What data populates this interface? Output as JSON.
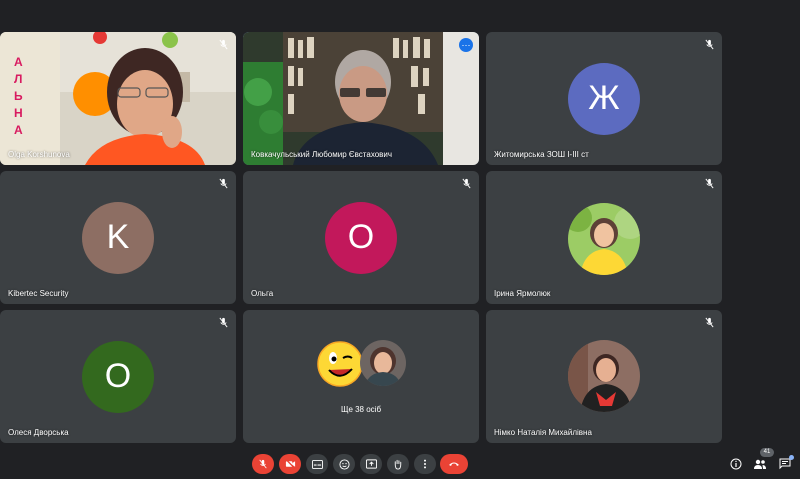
{
  "tiles": [
    {
      "name": "Olga Korshunova",
      "type": "video"
    },
    {
      "name": "Ковкачульський Любомир Євстахович",
      "type": "video",
      "active": true
    },
    {
      "name": "Житомирська ЗОШ І-ІІІ ст",
      "type": "avatar",
      "initial": "Ж",
      "color": "#5c6bc0"
    },
    {
      "name": "Kibertec Security",
      "type": "avatar",
      "initial": "K",
      "color": "#8d6e63"
    },
    {
      "name": "Ольга",
      "type": "avatar",
      "initial": "О",
      "color": "#c2185b"
    },
    {
      "name": "Ірина Ярмолюк",
      "type": "photo"
    },
    {
      "name": "Олеся Дворська",
      "type": "avatar",
      "initial": "О",
      "color": "#33691e"
    },
    {
      "others_label": "Ще 38 осіб",
      "type": "others"
    },
    {
      "name": "Німко Наталія Михайлівна",
      "type": "photo"
    }
  ],
  "poster_text": "АЛЬНА",
  "participants_count": "41",
  "colors": {
    "background": "#202124",
    "tile": "#3c4043",
    "danger": "#ea4335",
    "accent": "#1a73e8"
  },
  "toolbar_icons": [
    "mic-off-icon",
    "camera-off-icon",
    "captions-icon",
    "emoji-icon",
    "present-icon",
    "raise-hand-icon",
    "more-options-icon",
    "end-call-icon"
  ],
  "right_icons": [
    "info-icon",
    "people-icon",
    "chat-icon"
  ]
}
